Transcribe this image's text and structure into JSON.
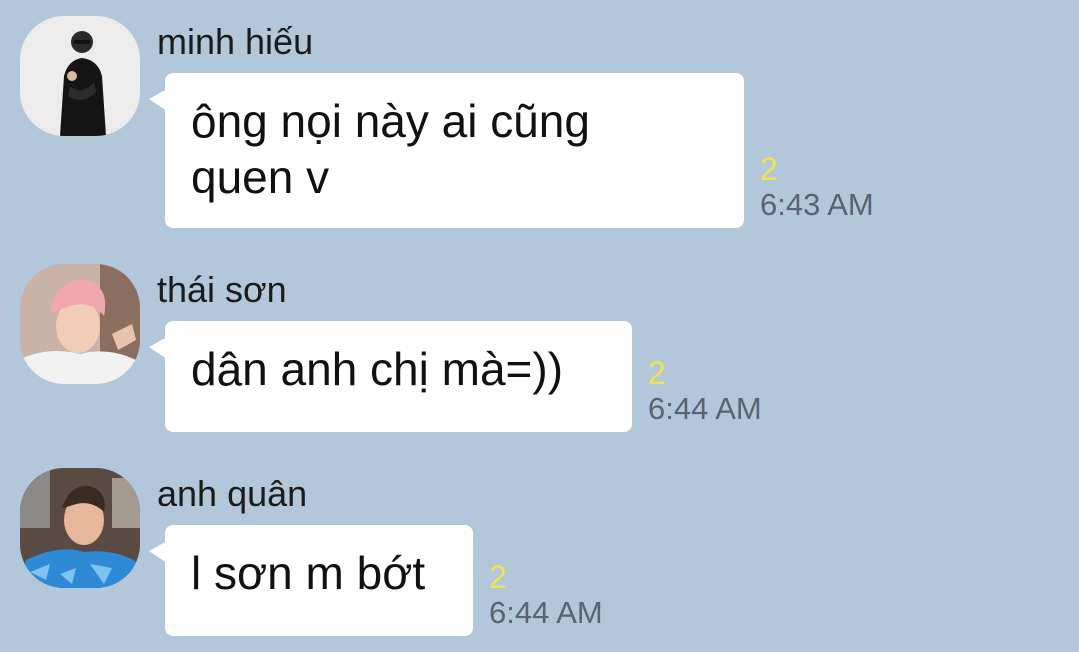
{
  "colors": {
    "background": "#b2c7da",
    "bubble": "#ffffff",
    "unread_count": "#f3e24a",
    "timestamp": "#5a6470"
  },
  "messages": [
    {
      "sender": "minh hiếu",
      "text": "ông nọi này ai cũng\nquen v",
      "unread": "2",
      "time": "6:43 AM",
      "avatar_icon": "profile-photo-black-outfit"
    },
    {
      "sender": "thái sơn",
      "text": "dân anh chị mà=))",
      "unread": "2",
      "time": "6:44 AM",
      "avatar_icon": "profile-photo-pink-hair"
    },
    {
      "sender": "anh quân",
      "text": "l sơn m bớt",
      "unread": "2",
      "time": "6:44 AM",
      "avatar_icon": "profile-photo-blue-shirt"
    }
  ]
}
